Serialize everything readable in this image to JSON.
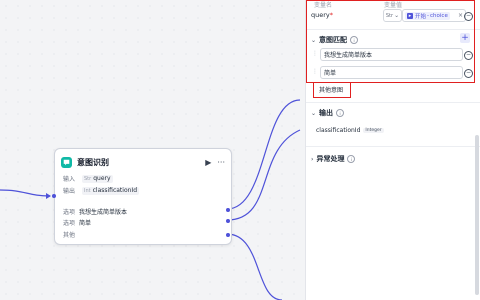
{
  "node": {
    "title": "意图识别",
    "run_icon": "▶",
    "more_icon": "···",
    "input_label": "输入",
    "input_type": "Str",
    "input_value": "query",
    "output_label": "输出",
    "output_type": "Int",
    "output_value": "classificationId",
    "options": [
      {
        "label": "选项",
        "value": "我想生成简单版本"
      },
      {
        "label": "选项",
        "value": "简单"
      },
      {
        "label": "其他",
        "value": ""
      }
    ]
  },
  "panel": {
    "col_name": "变量名",
    "col_value": "变量值",
    "query_name": "query",
    "required_mark": "*",
    "query_type": "Str",
    "ref_node": "开始",
    "ref_var": "choice",
    "intent_title": "意图匹配",
    "intents": [
      "我想生成简单版本",
      "简单"
    ],
    "other_intent": "其他意图",
    "output_title": "输出",
    "output_name": "classificationId",
    "output_type": "Integer",
    "error_title": "异常处理"
  },
  "colors": {
    "accent": "#4e52d9",
    "node_icon": "#10b9a6",
    "highlight": "#e02020"
  }
}
